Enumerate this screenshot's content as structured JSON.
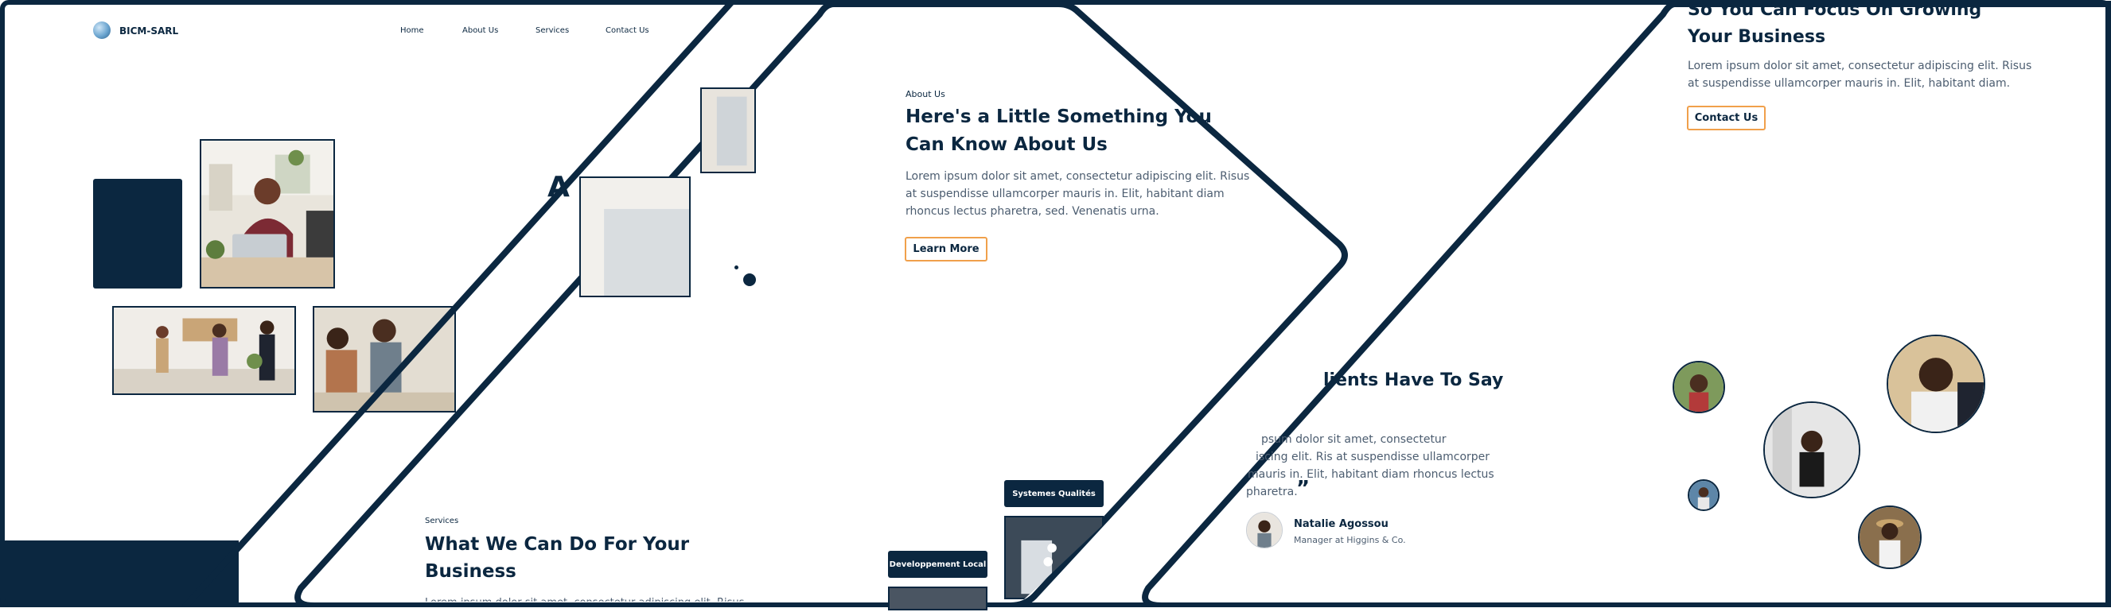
{
  "brand": {
    "name": "BICM-SARL"
  },
  "nav": [
    {
      "label": "Home"
    },
    {
      "label": "About Us"
    },
    {
      "label": "Services"
    },
    {
      "label": "Contact Us"
    }
  ],
  "hero": {
    "partial_heading": "A"
  },
  "about": {
    "eyebrow": "About Us",
    "heading_line1": "Here's a Little Something You",
    "heading_line2": "Can Know About Us",
    "body_line1": "Lorem ipsum dolor sit amet, consectetur adipiscing elit. Risus",
    "body_line2": "at suspendisse ullamcorper mauris in. Elit, habitant diam",
    "body_line3": "rhoncus lectus pharetra, sed. Venenatis urna.",
    "button": "Learn More"
  },
  "services": {
    "eyebrow": "Services",
    "heading_line1": "What We Can Do For Your",
    "heading_line2": "Business",
    "body_partial": "Lorem ipsum dolor sit amet, consectetur adipiscing elit. Risus",
    "tags": [
      {
        "label": "Systemes Qualités"
      },
      {
        "label": "Developpement Local"
      }
    ]
  },
  "testimonials": {
    "heading": "lients Have To Say",
    "body_line1": "psum dolor sit amet, consectetur",
    "body_line2": "iscing elit. Ris at suspendisse ullamcorper",
    "body_line3": "mauris in. Elit, habitant diam rhoncus lectus",
    "body_line4": "pharetra.",
    "quote_mark": "”",
    "person_name": "Natalie Agossou",
    "person_role": "Manager at Higgins & Co."
  },
  "cta": {
    "heading_line1": "So You Can Focus On Growing",
    "heading_line2": "Your Business",
    "body_line1": "Lorem ipsum dolor sit amet, consectetur adipiscing elit. Risus",
    "body_line2": "at suspendisse ullamcorper mauris in. Elit, habitant diam.",
    "button": "Contact Us"
  },
  "colors": {
    "navy": "#0b2740",
    "accent_orange": "#f0a04b",
    "text_muted": "#4c5d70"
  }
}
